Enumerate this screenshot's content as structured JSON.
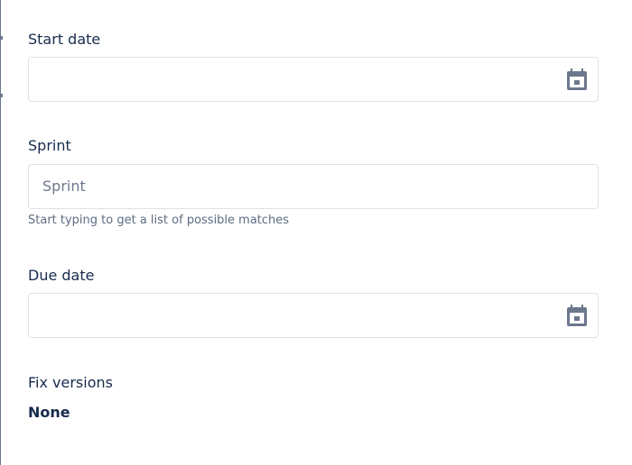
{
  "start_date": {
    "label": "Start date",
    "value": "",
    "icon": "calendar-icon"
  },
  "sprint": {
    "label": "Sprint",
    "placeholder": "Sprint",
    "helper": "Start typing to get a list of possible matches"
  },
  "due_date": {
    "label": "Due date",
    "value": "",
    "icon": "calendar-icon"
  },
  "fix_versions": {
    "label": "Fix versions",
    "value": "None"
  }
}
